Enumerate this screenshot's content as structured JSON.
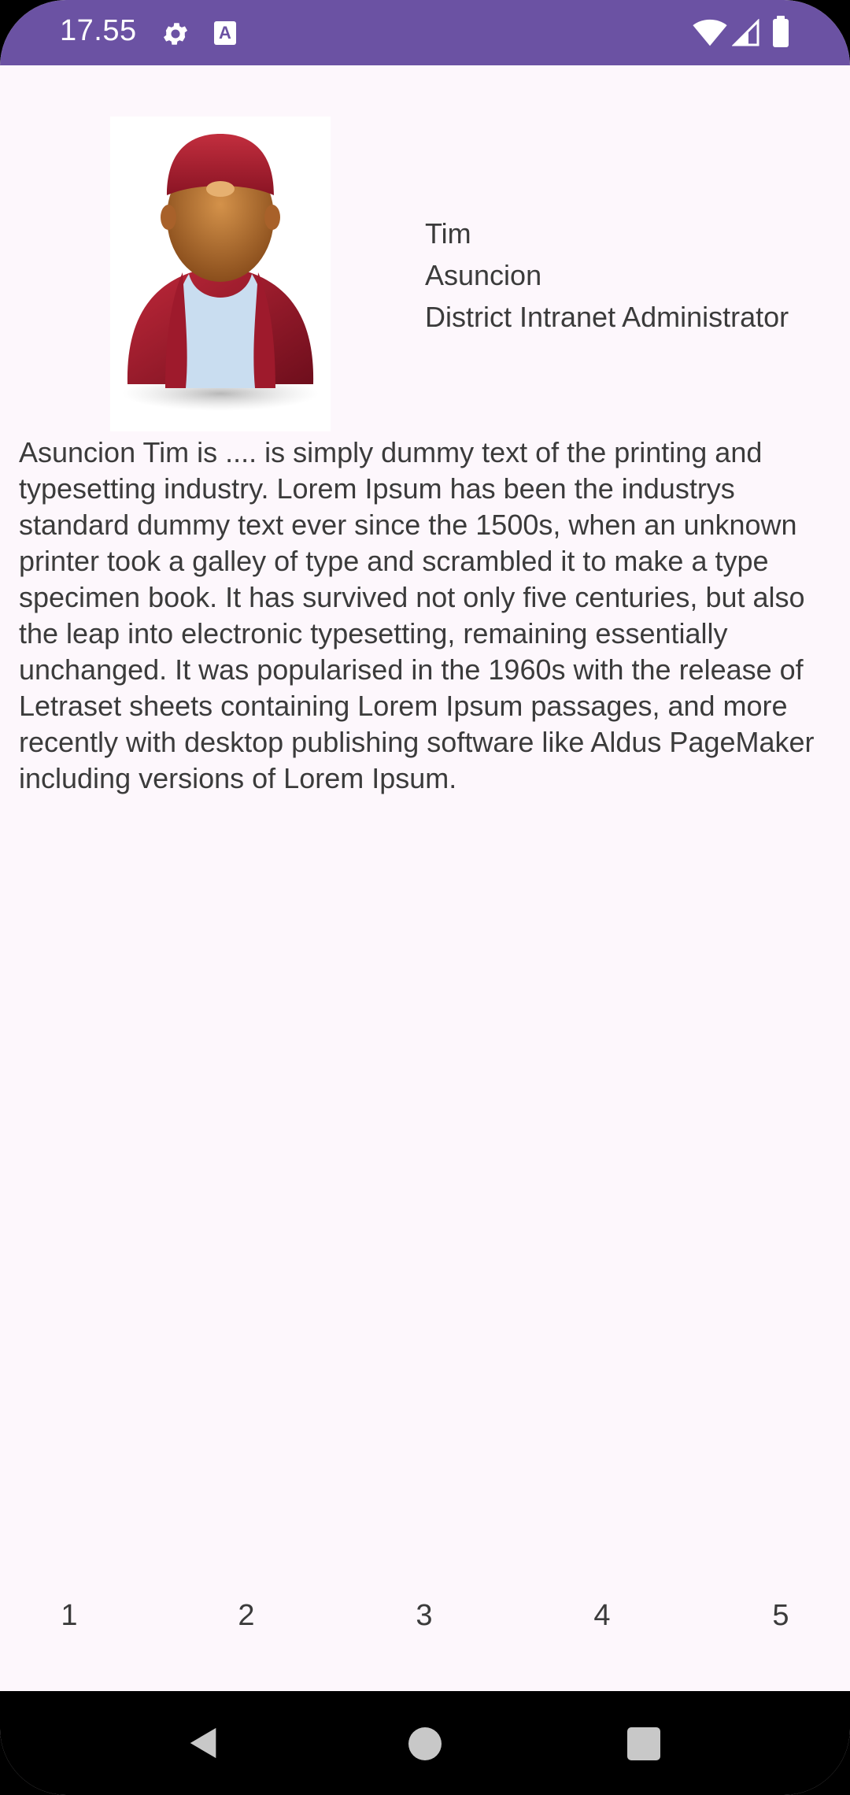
{
  "status_bar": {
    "time": "17.55",
    "background_color": "#6B52A3",
    "icons": [
      "gear-icon",
      "text-a-icon",
      "wifi-icon",
      "signal-icon",
      "battery-icon"
    ]
  },
  "profile": {
    "avatar_icon": "user-avatar-red-cap",
    "first_name": "Tim",
    "last_name": "Asuncion",
    "title": "District Intranet Administrator",
    "bio": "Asuncion Tim is .... is simply dummy text of the printing and typesetting industry. Lorem Ipsum has been the industrys standard dummy text ever since the 1500s, when an unknown printer took a galley of type and scrambled it to make a type specimen book. It has survived not only five centuries, but also the leap into electronic typesetting, remaining essentially unchanged. It was popularised in the 1960s with the release of Letraset sheets containing Lorem Ipsum passages, and more recently with desktop publishing software like Aldus PageMaker including versions of Lorem Ipsum."
  },
  "pager": {
    "items": [
      "1",
      "2",
      "3",
      "4",
      "5"
    ]
  },
  "nav_bar": {
    "icons": [
      "back-icon",
      "home-icon",
      "recents-icon"
    ]
  }
}
